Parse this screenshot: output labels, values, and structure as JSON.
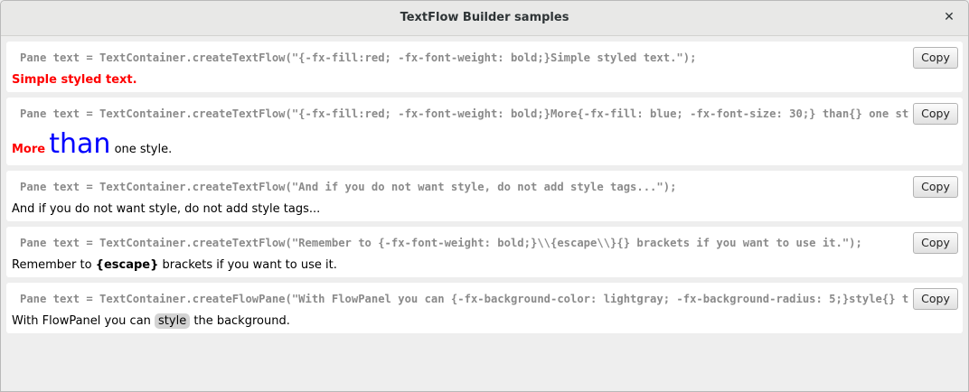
{
  "window": {
    "title": "TextFlow Builder samples",
    "close_glyph": "✕"
  },
  "copy_label": "Copy",
  "samples": [
    {
      "code": "Pane text = TextContainer.createTextFlow(\"{-fx-fill:red; -fx-font-weight: bold;}Simple styled text.\");",
      "result": {
        "text": "Simple styled text."
      }
    },
    {
      "code": "Pane text = TextContainer.createTextFlow(\"{-fx-fill:red; -fx-font-weight: bold;}More{-fx-fill: blue; -fx-font-size: 30;} than{} one style.\");",
      "result": {
        "part1": "More",
        "part2": "than",
        "part3": "one style."
      }
    },
    {
      "code": "Pane text = TextContainer.createTextFlow(\"And if you do not want style, do not add style tags...\");",
      "result": {
        "text": "And if you do not want style, do not add style tags..."
      }
    },
    {
      "code": "Pane text = TextContainer.createTextFlow(\"Remember to {-fx-font-weight: bold;}\\\\{escape\\\\}{} brackets if you want to use it.\");",
      "result": {
        "part1": "Remember to ",
        "part2": "{escape}",
        "part3": " brackets if you want to use it."
      }
    },
    {
      "code": "Pane text = TextContainer.createFlowPane(\"With FlowPanel you can {-fx-background-color: lightgray; -fx-background-radius: 5;}style{} the background.\");",
      "result": {
        "part1": "With FlowPanel you can ",
        "part2": "style",
        "part3": " the background."
      }
    }
  ],
  "colors": {
    "red": "#ff0000",
    "blue": "#0000ff",
    "chip": "#d3d3d3",
    "code": "#8a8a8a"
  }
}
